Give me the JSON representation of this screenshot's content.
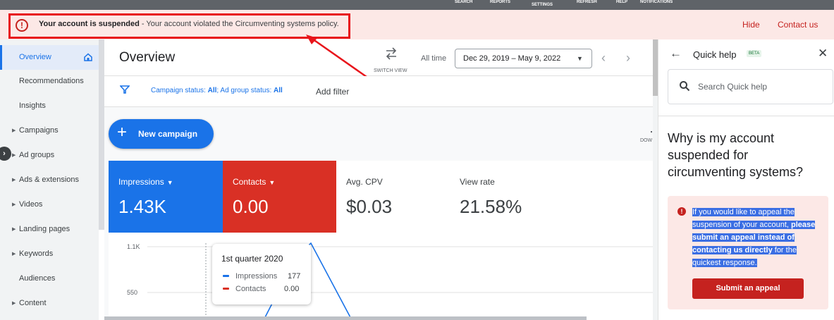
{
  "topbar": {
    "items": [
      "SEARCH",
      "REPORTS",
      "SETTINGS",
      "REFRESH",
      "HELP",
      "NOTIFICATIONS"
    ]
  },
  "banner": {
    "title": "Your account is suspended",
    "message": " - Your account violated the Circumventing systems policy.",
    "hide": "Hide",
    "contact": "Contact us"
  },
  "sidebar": {
    "items": [
      {
        "label": "Overview",
        "active": true
      },
      {
        "label": "Recommendations"
      },
      {
        "label": "Insights"
      },
      {
        "label": "Campaigns",
        "expandable": true
      },
      {
        "label": "Ad groups",
        "expandable": true
      },
      {
        "label": "Ads & extensions",
        "expandable": true
      },
      {
        "label": "Videos",
        "expandable": true
      },
      {
        "label": "Landing pages",
        "expandable": true
      },
      {
        "label": "Keywords",
        "expandable": true
      },
      {
        "label": "Audiences"
      },
      {
        "label": "Content",
        "expandable": true
      }
    ]
  },
  "header": {
    "title": "Overview",
    "switch_view": "SWITCH VIEW",
    "all_time": "All time",
    "date_range": "Dec 29, 2019 – May 9, 2022"
  },
  "filters": {
    "status_label_1": "Campaign status: ",
    "status_value_1": "All",
    "status_label_2": "; Ad group status: ",
    "status_value_2": "All",
    "add_filter": "Add filter"
  },
  "new_campaign": "New campaign",
  "download_label": "DOW",
  "metrics": [
    {
      "label": "Impressions",
      "value": "1.43K",
      "dropdown": true,
      "color": "#1a73e8"
    },
    {
      "label": "Contacts",
      "value": "0.00",
      "dropdown": true,
      "color": "#d93025"
    },
    {
      "label": "Avg. CPV",
      "value": "$0.03"
    },
    {
      "label": "View rate",
      "value": "21.58%"
    }
  ],
  "chart_data": {
    "type": "line",
    "y_ticks": [
      "1.1K",
      "550"
    ],
    "series": [
      {
        "name": "Impressions",
        "color": "#1a73e8"
      },
      {
        "name": "Contacts",
        "color": "#d93025"
      }
    ],
    "tooltip": {
      "title": "1st quarter 2020",
      "rows": [
        {
          "name": "Impressions",
          "value": "177"
        },
        {
          "name": "Contacts",
          "value": "0.00"
        }
      ]
    }
  },
  "quick_help": {
    "title": "Quick help",
    "beta": "BETA",
    "search_placeholder": "Search Quick help",
    "heading": "Why is my account suspended for circumventing systems?",
    "alert_part1": "If you would like to appeal the suspension of your account, ",
    "alert_bold": "please submit an appeal instead of contacting us directly",
    "alert_part2": " for the quickest response.",
    "appeal_button": "Submit an appeal"
  },
  "colors": {
    "accent": "#1a73e8",
    "error": "#c5221f",
    "annotation": "#e8141b"
  }
}
